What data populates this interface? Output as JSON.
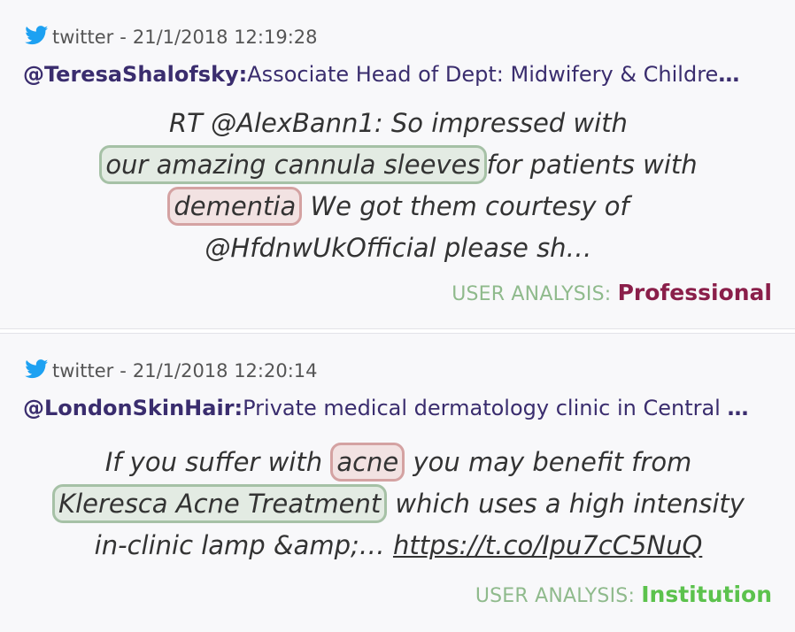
{
  "colors": {
    "twitter_blue": "#1da1f2",
    "handle_purple": "#3a2d6e",
    "analysis_label": "#8fba8c",
    "professional": "#8a1f4a",
    "institution": "#5cc24d",
    "highlight_green_border": "#a6c1a6",
    "highlight_red_border": "#d4a2a2"
  },
  "posts": [
    {
      "icon": "twitter-bird-icon",
      "source": "twitter",
      "separator": "-",
      "timestamp": "21/1/2018 12:19:28",
      "handle": "@TeresaShalofsky:",
      "bio": "Associate Head of Dept: Midwifery & Childre",
      "bio_ellipsis": "…",
      "tweet": {
        "l1": "RT @AlexBann1: So impressed with",
        "hl1": "our amazing cannula sleeves",
        "l2b": "for patients with",
        "hl2": "dementia",
        "l3b": " We got them courtesy of",
        "l4": "@HfdnwUkOfficial please sh…"
      },
      "analysis_label": "USER ANALYSIS: ",
      "analysis_value": "Professional"
    },
    {
      "icon": "twitter-bird-icon",
      "source": "twitter",
      "separator": "-",
      "timestamp": "21/1/2018 12:20:14",
      "handle": "@LondonSkinHair:",
      "bio": "Private medical dermatology clinic in Central ",
      "bio_ellipsis": "…",
      "tweet": {
        "l1a": "If you suffer with ",
        "hl1": "acne",
        "l1b": " you may benefit from",
        "hl2": "Kleresca Acne Treatment",
        "l2b": " which uses a high intensity",
        "l3a": "in-clinic lamp &amp;… ",
        "link": "https://t.co/Ipu7cC5NuQ"
      },
      "analysis_label": "USER ANALYSIS: ",
      "analysis_value": "Institution"
    }
  ]
}
